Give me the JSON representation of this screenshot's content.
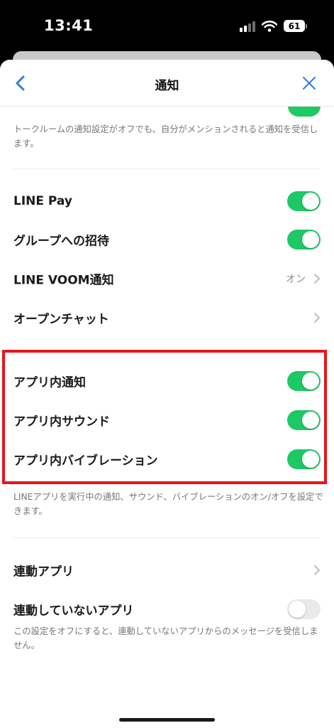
{
  "status_bar": {
    "time": "13:41",
    "battery": "61"
  },
  "nav": {
    "title": "通知"
  },
  "mention_desc": "トークルームの通知設定がオフでも、自分がメンションされると通知を受信します。",
  "rows": {
    "line_pay": {
      "label": "LINE Pay",
      "toggle": "on"
    },
    "group_invite": {
      "label": "グループへの招待",
      "toggle": "on"
    },
    "line_voom": {
      "label": "LINE VOOM通知",
      "value": "オン"
    },
    "open_chat": {
      "label": "オープンチャット"
    },
    "in_app_notification": {
      "label": "アプリ内通知",
      "toggle": "on"
    },
    "in_app_sound": {
      "label": "アプリ内サウンド",
      "toggle": "on"
    },
    "in_app_vibration": {
      "label": "アプリ内バイブレーション",
      "toggle": "on"
    },
    "linked_apps": {
      "label": "連動アプリ"
    },
    "unlinked_apps": {
      "label": "連動していないアプリ",
      "toggle": "off"
    }
  },
  "in_app_desc": "LINEアプリを実行中の通知、サウンド、バイブレーションのオン/オフを設定できます。",
  "unlinked_desc": "この設定をオフにすると、連動していないアプリからのメッセージを受信しません。",
  "colors": {
    "toggle_on": "#1ec865",
    "toggle_off": "#e9e9ea",
    "accent": "#2f7de0",
    "highlight": "#e8141b"
  }
}
